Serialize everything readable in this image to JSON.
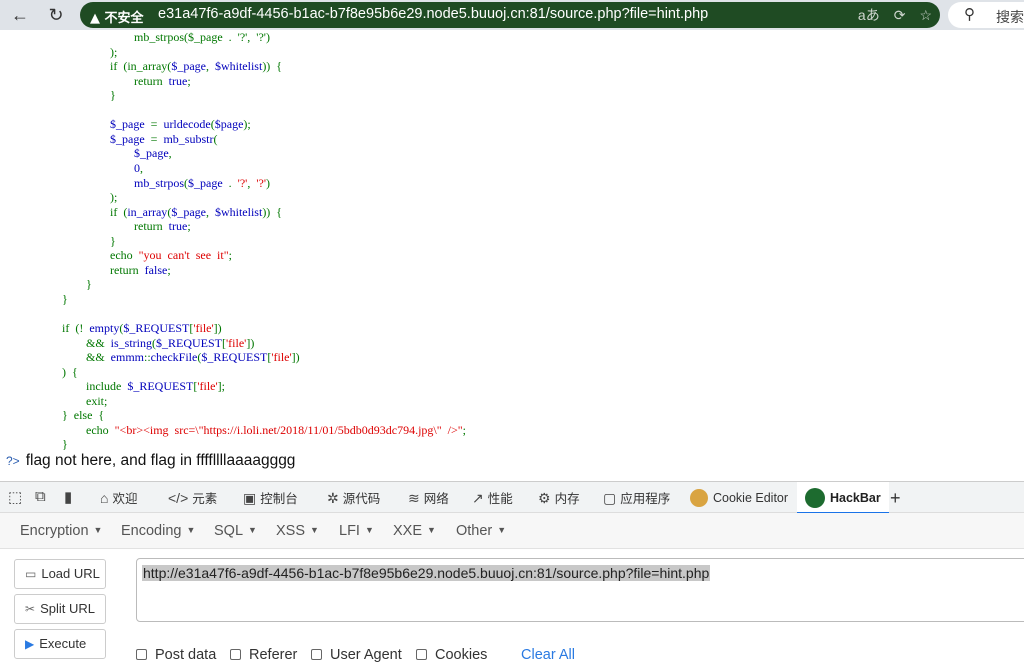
{
  "browser": {
    "security_label": "▲ 不安全",
    "url": "e31a47f6-a9df-4456-b1ac-b7f8e95b6e29.node5.buuoj.cn:81/source.php?file=hint.php",
    "search_label": "搜索"
  },
  "code_lines": [
    [
      [
        "g",
        "                        mb_strpos($_page  .  '?',  '?')"
      ]
    ],
    [
      [
        "g",
        "                );"
      ]
    ],
    [
      [
        "g",
        "                if  (in_array("
      ],
      [
        "b",
        "$_page"
      ],
      [
        "g",
        ",  "
      ],
      [
        "b",
        "$whitelist"
      ],
      [
        "g",
        "))  {"
      ]
    ],
    [
      [
        "g",
        "                        return  "
      ],
      [
        "b",
        "true"
      ],
      [
        "g",
        ";"
      ]
    ],
    [
      [
        "g",
        "                }"
      ]
    ],
    [
      [
        "g",
        ""
      ]
    ],
    [
      [
        "b",
        "                $_page"
      ],
      [
        "g",
        "  =  "
      ],
      [
        "b",
        "urldecode"
      ],
      [
        "g",
        "("
      ],
      [
        "b",
        "$page"
      ],
      [
        "g",
        ");"
      ]
    ],
    [
      [
        "b",
        "                $_page"
      ],
      [
        "g",
        "  =  "
      ],
      [
        "b",
        "mb_substr"
      ],
      [
        "g",
        "("
      ]
    ],
    [
      [
        "b",
        "                        $_page"
      ],
      [
        "g",
        ","
      ]
    ],
    [
      [
        "b",
        "                        0"
      ],
      [
        "g",
        ","
      ]
    ],
    [
      [
        "b",
        "                        mb_strpos"
      ],
      [
        "g",
        "("
      ],
      [
        "b",
        "$_page"
      ],
      [
        "g",
        "  .  "
      ],
      [
        "r",
        "'?'"
      ],
      [
        "g",
        ",  "
      ],
      [
        "r",
        "'?'"
      ],
      [
        "g",
        ")"
      ]
    ],
    [
      [
        "g",
        "                );"
      ]
    ],
    [
      [
        "g",
        "                if  ("
      ],
      [
        "b",
        "in_array"
      ],
      [
        "g",
        "("
      ],
      [
        "b",
        "$_page"
      ],
      [
        "g",
        ",  "
      ],
      [
        "b",
        "$whitelist"
      ],
      [
        "g",
        "))  {"
      ]
    ],
    [
      [
        "g",
        "                        return  "
      ],
      [
        "b",
        "true"
      ],
      [
        "g",
        ";"
      ]
    ],
    [
      [
        "g",
        "                }"
      ]
    ],
    [
      [
        "g",
        "                echo  "
      ],
      [
        "r",
        "\"you  can't  see  it\""
      ],
      [
        "g",
        ";"
      ]
    ],
    [
      [
        "g",
        "                return  "
      ],
      [
        "b",
        "false"
      ],
      [
        "g",
        ";"
      ]
    ],
    [
      [
        "g",
        "        }"
      ]
    ],
    [
      [
        "g",
        "}"
      ]
    ],
    [
      [
        "g",
        ""
      ]
    ],
    [
      [
        "g",
        "if  (!  "
      ],
      [
        "b",
        "empty"
      ],
      [
        "g",
        "("
      ],
      [
        "b",
        "$_REQUEST"
      ],
      [
        "g",
        "["
      ],
      [
        "r",
        "'file'"
      ],
      [
        "g",
        "])"
      ]
    ],
    [
      [
        "g",
        "        &&  "
      ],
      [
        "b",
        "is_string"
      ],
      [
        "g",
        "("
      ],
      [
        "b",
        "$_REQUEST"
      ],
      [
        "g",
        "["
      ],
      [
        "r",
        "'file'"
      ],
      [
        "g",
        "])"
      ]
    ],
    [
      [
        "g",
        "        &&  "
      ],
      [
        "b",
        "emmm"
      ],
      [
        "g",
        "::"
      ],
      [
        "b",
        "checkFile"
      ],
      [
        "g",
        "("
      ],
      [
        "b",
        "$_REQUEST"
      ],
      [
        "g",
        "["
      ],
      [
        "r",
        "'file'"
      ],
      [
        "g",
        "])"
      ]
    ],
    [
      [
        "g",
        ")  {"
      ]
    ],
    [
      [
        "g",
        "        include  "
      ],
      [
        "b",
        "$_REQUEST"
      ],
      [
        "g",
        "["
      ],
      [
        "r",
        "'file'"
      ],
      [
        "g",
        "];"
      ]
    ],
    [
      [
        "g",
        "        exit;"
      ]
    ],
    [
      [
        "g",
        "}  else  {"
      ]
    ],
    [
      [
        "g",
        "        echo  "
      ],
      [
        "r",
        "\"<br><img  src=\\\"https://i.loli.net/2018/11/01/5bdb0d93dc794.jpg\\\"  />\""
      ],
      [
        "g",
        ";"
      ]
    ],
    [
      [
        "g",
        "}"
      ]
    ]
  ],
  "output": {
    "prompt": "?>",
    "message": "flag not here, and flag in ffffllllaaaagggg"
  },
  "devtools": {
    "tabs": [
      {
        "name": "tab-welcome",
        "icon": "⌂",
        "label": "欢迎"
      },
      {
        "name": "tab-elements",
        "icon": "</>",
        "label": "元素"
      },
      {
        "name": "tab-console",
        "icon": "▣",
        "label": "控制台"
      },
      {
        "name": "tab-sources",
        "icon": "✲",
        "label": "源代码"
      },
      {
        "name": "tab-network",
        "icon": "≋",
        "label": "网络"
      },
      {
        "name": "tab-performance",
        "icon": "↗",
        "label": "性能"
      },
      {
        "name": "tab-memory",
        "icon": "⚙",
        "label": "内存"
      },
      {
        "name": "tab-application",
        "icon": "▢",
        "label": "应用程序"
      },
      {
        "name": "tab-cookie-editor",
        "icon": "",
        "label": "Cookie Editor"
      },
      {
        "name": "tab-hackbar",
        "icon": "",
        "label": "HackBar"
      }
    ],
    "add_tab": "+"
  },
  "hackbar": {
    "menu": [
      "Encryption",
      "Encoding",
      "SQL",
      "XSS",
      "LFI",
      "XXE",
      "Other"
    ],
    "buttons": {
      "load": "Load URL",
      "split": "Split URL",
      "execute": "Execute"
    },
    "url_value": "http://e31a47f6-a9df-4456-b1ac-b7f8e95b6e29.node5.buuoj.cn:81/source.php?file=hint.php",
    "options": [
      "Post data",
      "Referer",
      "User Agent",
      "Cookies"
    ],
    "clear_all": "Clear All"
  },
  "colors": {
    "php_keyword": "#007700",
    "php_default": "#0000bb",
    "php_string": "#dd0000",
    "devtools_active": "#1a73e8"
  }
}
